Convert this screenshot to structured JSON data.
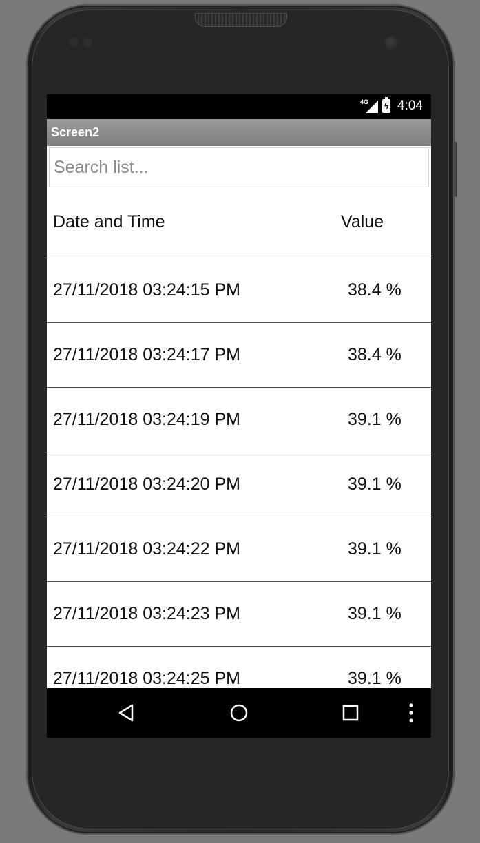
{
  "statusbar": {
    "network_label": "4G",
    "time": "4:04"
  },
  "app": {
    "title": "Screen2"
  },
  "search": {
    "placeholder": "Search list..."
  },
  "table": {
    "headers": {
      "date": "Date and Time",
      "value": "Value"
    },
    "rows": [
      {
        "date": "27/11/2018 03:24:15 PM",
        "value": "38.4 %"
      },
      {
        "date": "27/11/2018 03:24:17 PM",
        "value": "38.4 %"
      },
      {
        "date": "27/11/2018 03:24:19 PM",
        "value": "39.1 %"
      },
      {
        "date": "27/11/2018 03:24:20 PM",
        "value": "39.1 %"
      },
      {
        "date": "27/11/2018 03:24:22 PM",
        "value": "39.1 %"
      },
      {
        "date": "27/11/2018 03:24:23 PM",
        "value": "39.1 %"
      },
      {
        "date": "27/11/2018 03:24:25 PM",
        "value": "39.1 %"
      }
    ]
  },
  "navbar": {
    "icons": [
      "back-icon",
      "home-icon",
      "recents-icon",
      "overflow-menu-icon"
    ]
  },
  "colors": {
    "titlebar": "#8c8c8c",
    "statusbar": "#000000",
    "navbar": "#000000",
    "background": "#ffffff"
  }
}
